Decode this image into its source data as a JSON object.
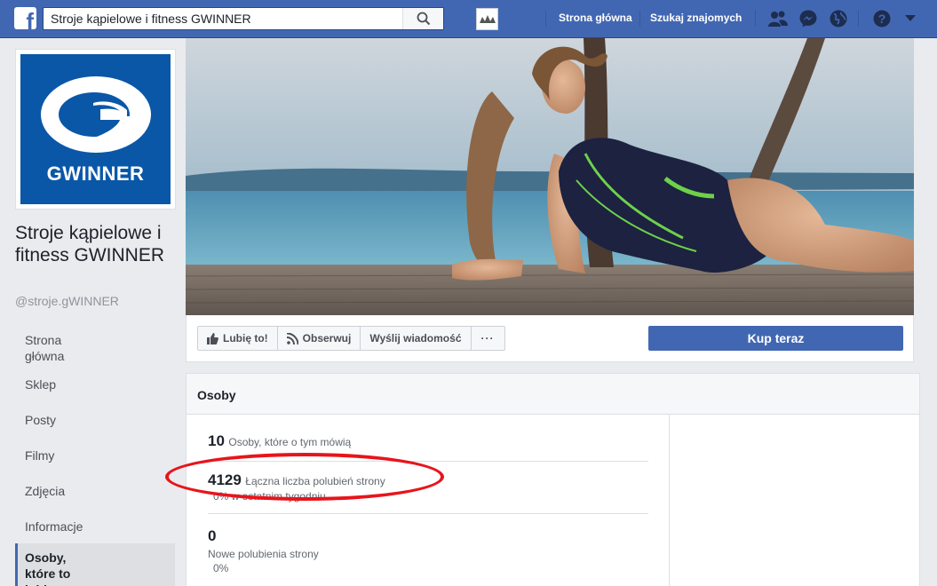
{
  "topbar": {
    "logo_letter": "f",
    "search_value": "Stroje kąpielowe i fitness GWINNER",
    "nav_home": "Strona główna",
    "nav_find_friends": "Szukaj znajomych",
    "icons": [
      "friends-icon",
      "messenger-icon",
      "globe-icon",
      "help-icon",
      "chevron-down-icon"
    ],
    "color": "#4267b2"
  },
  "page": {
    "brand": "GWINNER",
    "name": "Stroje kąpielowe i fitness GWINNER",
    "handle": "@stroje.gWINNER"
  },
  "left_nav": {
    "items": [
      {
        "label": "Strona główna"
      },
      {
        "label": "Sklep"
      },
      {
        "label": "Posty"
      },
      {
        "label": "Filmy"
      },
      {
        "label": "Zdjęcia"
      },
      {
        "label": "Informacje"
      },
      {
        "label": "Osoby, które to lubią"
      }
    ]
  },
  "actions": {
    "like": "Lubię to!",
    "follow": "Obserwuj",
    "message": "Wyślij wiadomość",
    "more": "···",
    "buy": "Kup teraz"
  },
  "people": {
    "title": "Osoby",
    "talking_count": "10",
    "talking_label": "Osoby, które o tym mówią",
    "likes_count": "4129",
    "likes_label": "Łączna liczba polubień strony",
    "likes_sub": "0% w ostatnim tygodniu",
    "new_count": "0",
    "new_label": "Nowe polubienia strony",
    "new_sub": "0%"
  }
}
